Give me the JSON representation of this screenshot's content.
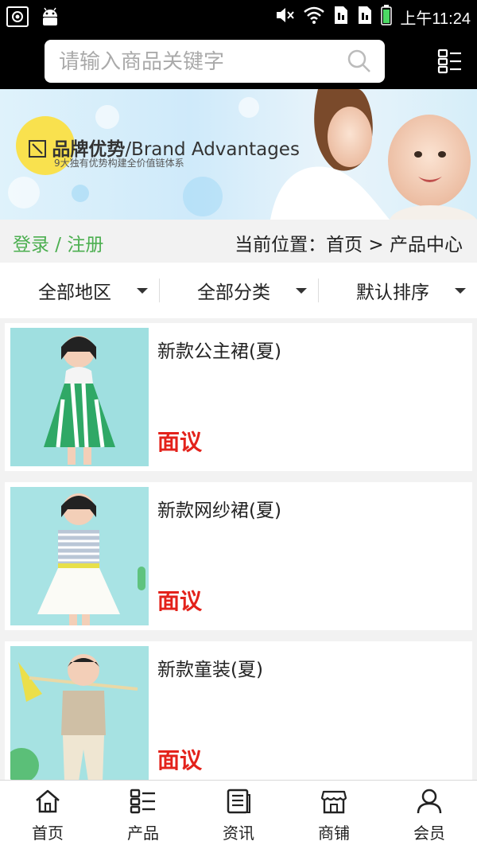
{
  "status_bar": {
    "time": "上午11:24",
    "left_icons": [
      "screenshot-icon",
      "android-icon"
    ],
    "right_icons": [
      "mute-icon",
      "wifi-icon",
      "sim1-icon",
      "sim2-icon",
      "battery-icon"
    ]
  },
  "search": {
    "placeholder": "请输入商品关键字",
    "value": ""
  },
  "banner": {
    "title_cn": "品牌优势",
    "title_en": "/Brand Advantages",
    "subtitle": "9大独有优势构建全价值链体系"
  },
  "nav": {
    "login_label": "登录 / 注册",
    "breadcrumb": "当前位置：首页 > 产品中心"
  },
  "filters": [
    {
      "label": "全部地区"
    },
    {
      "label": "全部分类"
    },
    {
      "label": "默认排序"
    }
  ],
  "products": [
    {
      "name": "新款公主裙(夏)",
      "price": "面议"
    },
    {
      "name": "新款网纱裙(夏)",
      "price": "面议"
    },
    {
      "name": "新款童装(夏)",
      "price": "面议"
    }
  ],
  "bottom_nav": [
    {
      "label": "首页",
      "icon": "home-icon"
    },
    {
      "label": "产品",
      "icon": "grid-list-icon"
    },
    {
      "label": "资讯",
      "icon": "news-icon"
    },
    {
      "label": "商铺",
      "icon": "shop-icon"
    },
    {
      "label": "会员",
      "icon": "user-icon"
    }
  ],
  "colors": {
    "accent_green": "#4caf50",
    "price_red": "#e3221b",
    "header_bg": "#000000",
    "page_bg": "#f2f2f2"
  }
}
